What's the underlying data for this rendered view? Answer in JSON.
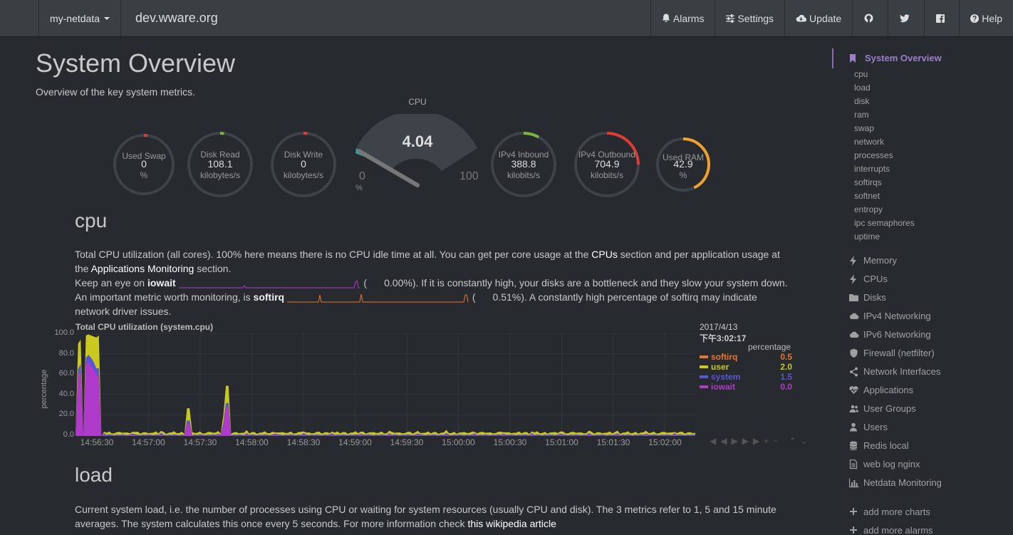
{
  "navbar": {
    "brand": "my-netdata",
    "hostname": "dev.wware.org",
    "alarms": "Alarms",
    "settings": "Settings",
    "update": "Update",
    "help": "Help"
  },
  "page": {
    "title": "System Overview",
    "description": "Overview of the key system metrics."
  },
  "gauges": [
    {
      "label": "Used Swap",
      "value": "0",
      "unit": "%",
      "color": "#e03c31",
      "fraction": 0.0
    },
    {
      "label": "Disk Read",
      "value": "108.1",
      "unit": "kilobytes/s",
      "color": "#7cb342",
      "fraction": 0.02
    },
    {
      "label": "Disk Write",
      "value": "0",
      "unit": "kilobytes/s",
      "color": "#e03c31",
      "fraction": 0.0
    },
    {
      "label": "IPv4 Inbound",
      "value": "388.8",
      "unit": "kilobits/s",
      "color": "#7cb342",
      "fraction": 0.08
    },
    {
      "label": "IPv4 Outbound",
      "value": "704.9",
      "unit": "kilobits/s",
      "color": "#e03c31",
      "fraction": 0.25
    },
    {
      "label": "Used RAM",
      "value": "42.9",
      "unit": "%",
      "color": "#f0a030",
      "fraction": 0.429
    }
  ],
  "cpu_gauge": {
    "title": "CPU",
    "value": "4.04",
    "min": "0",
    "max": "100",
    "unit": "%",
    "level": 0.0404
  },
  "cpu_section": {
    "title": "cpu",
    "line1a": "Total CPU utilization (all cores). 100% here means there is no CPU idle time at all. You can get per core usage at the ",
    "line1_link": "CPUs",
    "line1b": " section and per application usage at",
    "line2a": "the ",
    "line2_link": "Applications Monitoring",
    "line2b": " section.",
    "line3a": "Keep an eye on ",
    "line3_key": "iowait",
    "line3_val": "0.00%",
    "line3b": "). If it is constantly high, your disks are a bottleneck and they slow your system down.",
    "line4a": "An important metric worth monitoring, is ",
    "line4_key": "softirq",
    "line4_val": "0.51%",
    "line4b": "). A constantly high percentage of softirq may indicate",
    "line5": "network driver issues."
  },
  "legend": {
    "date": "2017/4/13",
    "time": "下午3:02:17",
    "units": "percentage"
  },
  "chart_data": {
    "type": "area",
    "title": "Total CPU utilization (system.cpu)",
    "ylabel": "percentage",
    "ylim": [
      0,
      100
    ],
    "yticks": [
      "100.0",
      "80.0",
      "60.0",
      "40.0",
      "20.0",
      "0.0"
    ],
    "xticks": [
      "14:56:30",
      "14:57:00",
      "14:57:30",
      "14:58:00",
      "14:58:30",
      "14:59:00",
      "14:59:30",
      "15:00:00",
      "15:00:30",
      "15:01:00",
      "15:01:30",
      "15:02:00"
    ],
    "series": [
      {
        "name": "softirq",
        "color": "#e8762b",
        "value": "0.5"
      },
      {
        "name": "user",
        "color": "#c8c820",
        "value": "2.0"
      },
      {
        "name": "system",
        "color": "#5a55d6",
        "value": "1.5"
      },
      {
        "name": "iowait",
        "color": "#b03ac9",
        "value": "0.0"
      }
    ],
    "stacked": {
      "iowait": [
        0,
        60,
        62,
        0,
        70,
        72,
        68,
        65,
        60,
        58,
        0,
        0,
        0,
        0,
        0,
        0,
        0,
        0,
        0,
        0,
        0,
        0,
        0,
        0,
        0,
        0,
        0,
        0,
        0,
        0,
        0,
        0,
        0,
        0,
        0,
        0,
        0,
        0,
        0,
        0,
        0,
        0,
        0,
        0,
        0,
        0,
        0,
        0,
        0,
        0,
        0,
        0,
        0,
        0,
        0,
        0,
        0,
        0,
        0,
        0,
        0,
        0,
        0,
        0,
        0,
        0,
        0,
        0,
        0,
        0,
        0,
        0,
        0,
        0,
        0,
        0,
        0,
        0,
        0,
        0,
        0,
        0,
        0,
        0,
        0,
        0,
        0,
        0,
        0,
        0,
        0,
        0,
        0,
        0,
        0,
        0,
        0,
        0,
        0,
        0,
        0,
        0,
        0,
        0,
        0,
        0,
        0,
        0,
        0,
        0,
        0,
        0,
        0,
        0,
        0,
        0,
        0,
        0,
        0,
        0,
        0,
        0,
        0,
        0,
        0,
        0,
        0,
        0,
        0,
        0,
        0,
        0,
        0,
        0,
        0,
        0,
        0,
        0,
        0,
        0,
        0,
        0,
        0,
        0,
        0,
        0,
        0,
        0,
        0,
        0,
        0,
        0,
        0,
        0,
        0,
        0,
        0,
        0,
        0,
        0,
        0,
        0,
        0,
        0,
        0,
        0,
        0,
        0,
        0,
        0,
        0,
        0,
        0,
        0,
        0,
        0,
        0,
        0,
        0,
        0,
        0,
        0,
        0,
        0,
        0,
        0,
        0,
        0,
        0,
        0,
        0,
        0,
        0,
        0,
        0,
        0,
        0,
        0,
        0,
        0,
        0,
        0,
        0,
        0,
        0,
        0,
        0,
        0,
        0,
        0,
        0,
        0,
        0,
        0,
        0,
        0,
        0,
        0,
        0,
        0,
        0,
        0,
        0,
        0,
        0,
        0,
        0,
        0,
        0,
        0,
        0,
        0,
        0,
        0,
        0,
        0,
        0,
        0
      ],
      "system": [
        0,
        5,
        8,
        0,
        6,
        7,
        8,
        7,
        6,
        8,
        0,
        0,
        0,
        0,
        0,
        0,
        0,
        0,
        0,
        0,
        0,
        0,
        0,
        0,
        0,
        0,
        0,
        0,
        0,
        0,
        0,
        0,
        0,
        0,
        0,
        0,
        0,
        0,
        0,
        0,
        0,
        0,
        0,
        0,
        0,
        0,
        0,
        0,
        0,
        0,
        0,
        0,
        0,
        0,
        0,
        0,
        0,
        0,
        0,
        0,
        0,
        0,
        0,
        0,
        0,
        0,
        0,
        0,
        0,
        0,
        0,
        0,
        0,
        0,
        0,
        0,
        0,
        0,
        0,
        0,
        0,
        0,
        0,
        0,
        0,
        0,
        0,
        0,
        0,
        0,
        0,
        0,
        0,
        0,
        0,
        0,
        0,
        0,
        0,
        0,
        0,
        0,
        0,
        0,
        0,
        0,
        0,
        0,
        0,
        0,
        0,
        0,
        0,
        0,
        0,
        0,
        0,
        0,
        0,
        0,
        0,
        0,
        0,
        0,
        0,
        0,
        0,
        0,
        0,
        0,
        0,
        0,
        0,
        0,
        0,
        0,
        0,
        0,
        0,
        0,
        0,
        0,
        0,
        0,
        0,
        0,
        0,
        0,
        0,
        0,
        0,
        0,
        0,
        0,
        0,
        0,
        0,
        0,
        0,
        0,
        0,
        0,
        0,
        0,
        0,
        0,
        0,
        0,
        0,
        0,
        0,
        0,
        0,
        0,
        0,
        0,
        0,
        0,
        0,
        0,
        0,
        0,
        0,
        0,
        0,
        0,
        0,
        0,
        0,
        0,
        0,
        0,
        0,
        0,
        0,
        0,
        0,
        0,
        0,
        0,
        0,
        0,
        0,
        0,
        0,
        0,
        0,
        0,
        0,
        0,
        0,
        0,
        0,
        0,
        0,
        0,
        0,
        0,
        0,
        0,
        0,
        0,
        0,
        0,
        0,
        0,
        0,
        0,
        0,
        0,
        0,
        0,
        0,
        0,
        0,
        0,
        0,
        0
      ],
      "user": [
        0,
        25,
        24,
        0,
        22,
        20,
        22,
        25,
        30,
        32,
        0,
        0,
        0,
        0,
        0,
        0,
        0,
        0,
        0,
        0,
        0,
        0,
        0,
        0,
        0,
        0,
        0,
        0,
        0,
        0,
        0,
        0,
        0,
        0,
        0,
        0,
        0,
        0,
        0,
        0,
        0,
        0,
        0,
        0,
        0,
        0,
        0,
        0,
        0,
        0,
        0,
        0,
        0,
        0,
        0,
        0,
        0,
        0,
        0,
        0,
        0,
        0,
        0,
        0,
        0,
        0,
        0,
        0,
        0,
        0,
        0,
        0,
        0,
        0,
        0,
        0,
        0,
        0,
        0,
        0,
        0,
        0,
        0,
        0,
        0,
        0,
        0,
        0,
        0,
        0,
        0,
        0,
        0,
        0,
        0,
        0,
        0,
        0,
        0,
        0,
        0,
        0,
        0,
        0,
        0,
        0,
        0,
        0,
        0,
        0,
        0,
        0,
        0,
        0,
        0,
        0,
        0,
        0,
        0,
        0,
        0,
        0,
        0,
        0,
        0,
        0,
        0,
        0,
        0,
        0,
        0,
        0,
        0,
        0,
        0,
        0,
        0,
        0,
        0,
        0,
        0,
        0,
        0,
        0,
        0,
        0,
        0,
        0,
        0,
        0,
        0,
        0,
        0,
        0,
        0,
        0,
        0,
        0,
        0,
        0,
        0,
        0,
        0,
        0,
        0,
        0,
        0,
        0,
        0,
        0,
        0,
        0,
        0,
        0,
        0,
        0,
        0,
        0,
        0,
        0,
        0,
        0,
        0,
        0,
        0,
        0,
        0,
        0,
        0,
        0,
        0,
        0,
        0,
        0,
        0,
        0,
        0,
        0,
        0,
        0,
        0,
        0,
        0,
        0,
        0,
        0,
        0,
        0,
        0,
        0,
        0,
        0,
        0,
        0,
        0,
        0,
        0,
        0,
        0,
        0,
        0,
        0,
        0,
        0,
        0,
        0,
        0,
        0,
        0,
        0,
        0,
        0,
        0,
        0,
        0,
        0,
        0,
        0
      ]
    }
  },
  "load_section": {
    "title": "load",
    "line1": "Current system load, i.e. the number of processes using CPU or waiting for system resources (usually CPU and disk). The 3 metrics refer to 1, 5 and 15 minute",
    "line2a": "averages. The system calculates this once every 5 seconds. For more information check ",
    "line2_link": "this wikipedia article"
  },
  "sidebar": {
    "active": "System Overview",
    "sub": [
      "cpu",
      "load",
      "disk",
      "ram",
      "swap",
      "network",
      "processes",
      "interrupts",
      "softirqs",
      "softnet",
      "entropy",
      "ipc semaphores",
      "uptime"
    ],
    "items": [
      {
        "label": "Memory",
        "icon": "bolt-icon"
      },
      {
        "label": "CPUs",
        "icon": "bolt-icon"
      },
      {
        "label": "Disks",
        "icon": "folder-icon"
      },
      {
        "label": "IPv4 Networking",
        "icon": "cloud-icon"
      },
      {
        "label": "IPv6 Networking",
        "icon": "cloud-icon"
      },
      {
        "label": "Firewall (netfilter)",
        "icon": "shield-icon"
      },
      {
        "label": "Network Interfaces",
        "icon": "share-icon"
      },
      {
        "label": "Applications",
        "icon": "heartbeat-icon"
      },
      {
        "label": "User Groups",
        "icon": "users-icon"
      },
      {
        "label": "Users",
        "icon": "user-icon"
      },
      {
        "label": "Redis local",
        "icon": "database-icon"
      },
      {
        "label": "web log nginx",
        "icon": "file-icon"
      },
      {
        "label": "Netdata Monitoring",
        "icon": "bar-chart-icon"
      },
      {
        "label": "add more charts",
        "icon": "plus-icon"
      },
      {
        "label": "add more alarms",
        "icon": "plus-icon"
      }
    ]
  }
}
